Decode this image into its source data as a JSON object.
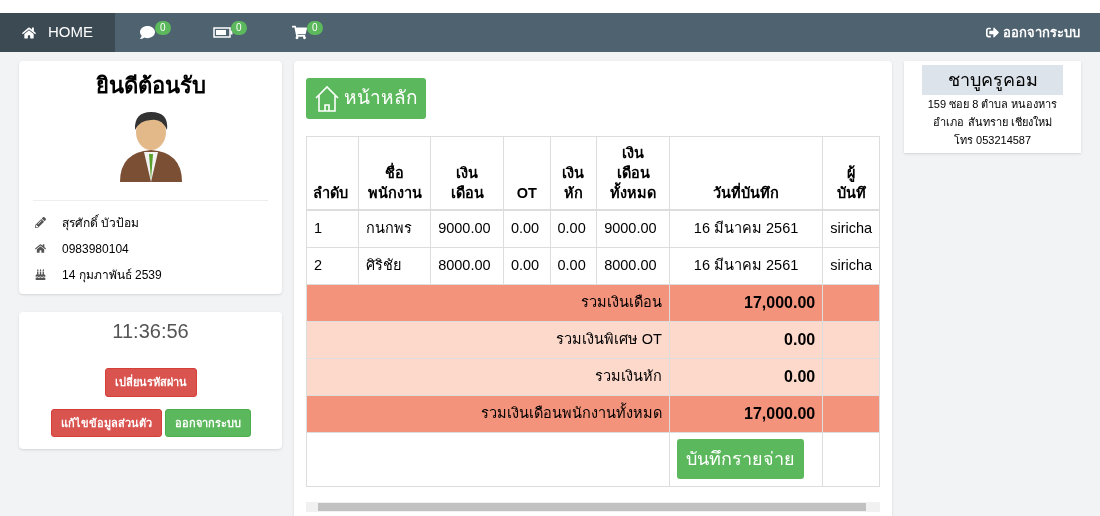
{
  "navbar": {
    "home": "HOME",
    "badges": [
      {
        "kind": "comment",
        "count": "0"
      },
      {
        "kind": "battery",
        "count": "0"
      },
      {
        "kind": "cart",
        "count": "0"
      }
    ],
    "logout": "ออกจากระบบ"
  },
  "profile": {
    "title": "ยินดีต้อนรับ",
    "details": [
      {
        "kind": "pencil",
        "text": "สุรศักดิ์ บัวป้อม"
      },
      {
        "kind": "home",
        "text": "0983980104"
      },
      {
        "kind": "cake",
        "text": "14 กุมภาพันธ์ 2539"
      }
    ]
  },
  "clock": {
    "time": "11:36:56",
    "buttons": [
      {
        "label": "เปลี่ยนรหัสผ่าน",
        "kind": "danger"
      },
      {
        "label": "แก้ไขข้อมูลส่วนตัว",
        "kind": "danger"
      },
      {
        "label": "ออกจากระบบ",
        "kind": "success"
      }
    ]
  },
  "main": {
    "home_button": "หน้าหลัก",
    "table": {
      "columns": [
        "ลำดับ",
        "ชื่อ\nพนักงาน",
        "เงิน\nเดือน",
        "OT",
        "เงิน\nหัก",
        "เงิน\nเดือน\nทั้งหมด",
        "วันที่บันทึก",
        "ผู้\nบันทึ"
      ],
      "rows": [
        [
          "1",
          "กนกพร",
          "9000.00",
          "0.00",
          "0.00",
          "9000.00",
          "16 มีนาคม 2561",
          "siricha"
        ],
        [
          "2",
          "ศิริชัย",
          "8000.00",
          "0.00",
          "0.00",
          "8000.00",
          "16 มีนาคม 2561",
          "siricha"
        ]
      ],
      "totals": [
        {
          "label": "รวมเงินเดือน",
          "value": "17,000.00",
          "kind": "strong"
        },
        {
          "label": "รวมเงินพิเศษ OT",
          "value": "0.00",
          "kind": "light"
        },
        {
          "label": "รวมเงินหัก",
          "value": "0.00",
          "kind": "light"
        },
        {
          "label": "รวมเงินเดือนพนักงานทั้งหมด",
          "value": "17,000.00",
          "kind": "strong"
        }
      ],
      "save_button": "บันทึกรายจ่าย"
    }
  },
  "shop": {
    "name": "ชาบูครูคอม",
    "address": [
      "159 ซอย 8 ตำบล หนองหาร",
      "อำเภอ สันทราย เชียงใหม่",
      "โทร 053214587"
    ]
  }
}
